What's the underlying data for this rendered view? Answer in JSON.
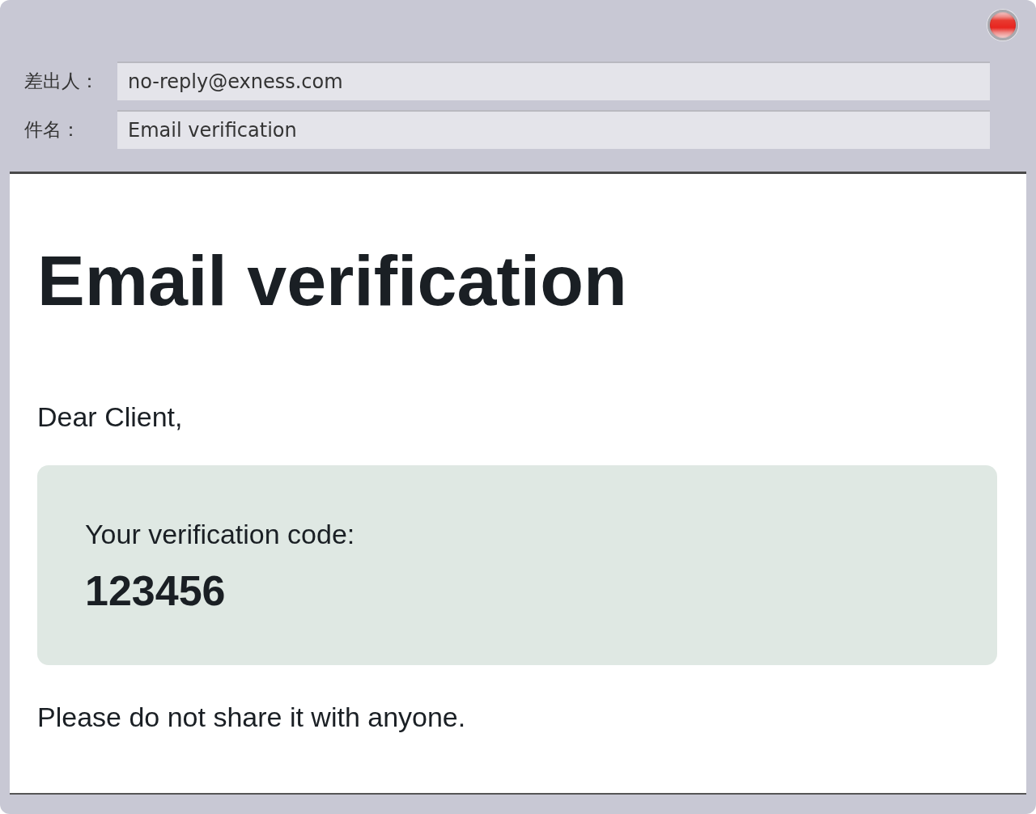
{
  "header": {
    "fields": [
      {
        "label": "差出人：",
        "value": "no-reply@exness.com"
      },
      {
        "label": "件名：",
        "value": "Email verification"
      }
    ]
  },
  "message": {
    "heading": "Email verification",
    "greeting": "Dear Client,",
    "code_box": {
      "label": "Your verification code:",
      "code": "123456"
    },
    "note": "Please do not share it with anyone."
  }
}
